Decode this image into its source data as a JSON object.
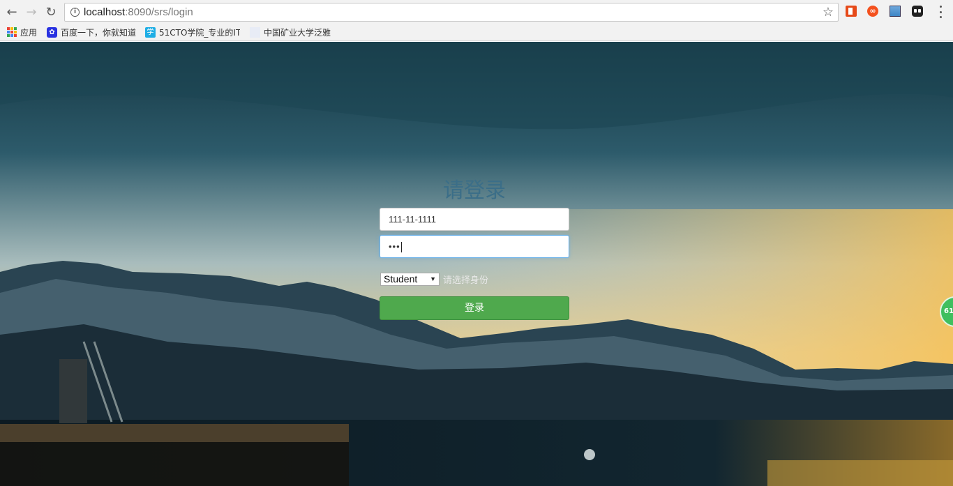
{
  "browser": {
    "url_host": "localhost",
    "url_rest": ":8090/srs/login",
    "bookmarks": [
      {
        "label": "应用"
      },
      {
        "label": "百度一下，你就知道"
      },
      {
        "label": "51CTO学院_专业的IT"
      },
      {
        "label": "中国矿业大学泛雅"
      }
    ]
  },
  "login": {
    "title": "请登录",
    "username_value": "111-11-1111",
    "password_mask": "•••",
    "role_selected": "Student",
    "role_hint": "请选择身份",
    "submit_label": "登录"
  },
  "side_badge": "61",
  "colors": {
    "title": "#3b6e88",
    "button": "#4fa94d",
    "focus": "#66afe9"
  }
}
